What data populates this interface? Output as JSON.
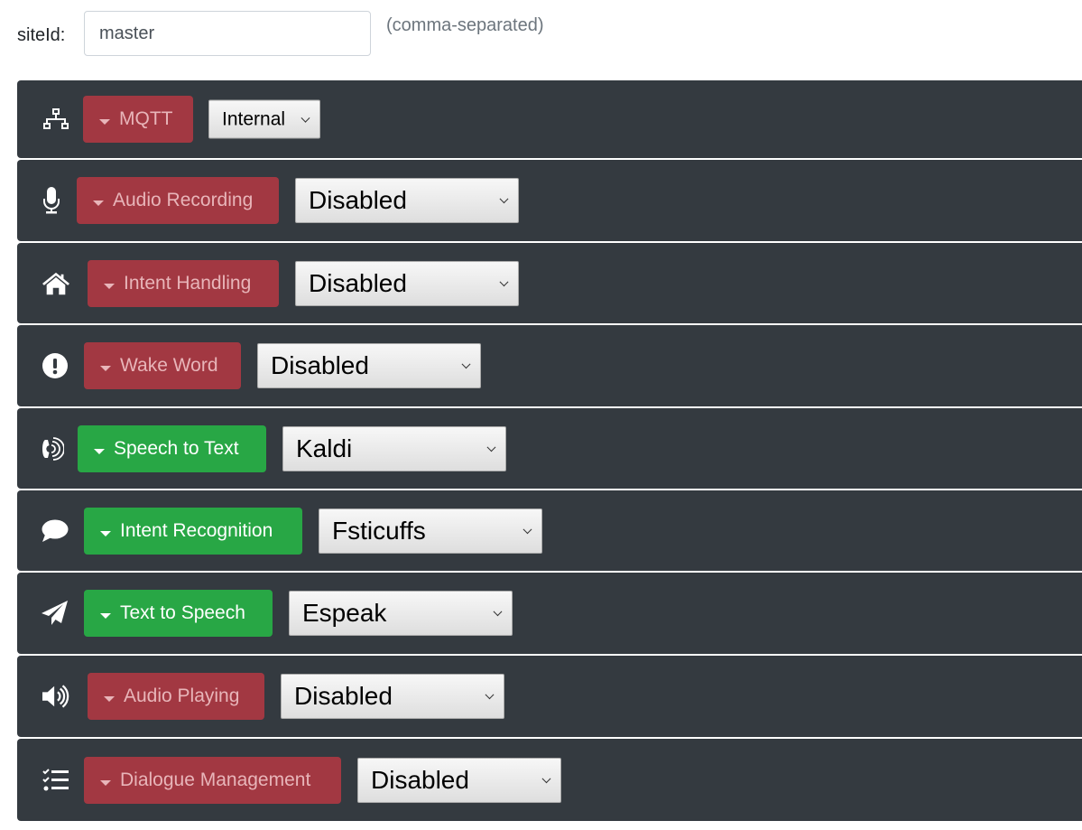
{
  "site": {
    "label": "siteId:",
    "value": "master",
    "hint": "(comma-separated)"
  },
  "services": [
    {
      "name": "MQTT",
      "icon": "network-icon",
      "state": "disabled",
      "selected": "Internal"
    },
    {
      "name": "Audio Recording",
      "icon": "microphone-icon",
      "state": "disabled",
      "selected": "Disabled"
    },
    {
      "name": "Intent Handling",
      "icon": "home-icon",
      "state": "disabled",
      "selected": "Disabled"
    },
    {
      "name": "Wake Word",
      "icon": "exclamation-circle-icon",
      "state": "disabled",
      "selected": "Disabled"
    },
    {
      "name": "Speech to Text",
      "icon": "phone-volume-icon",
      "state": "enabled",
      "selected": "Kaldi"
    },
    {
      "name": "Intent Recognition",
      "icon": "comment-icon",
      "state": "enabled",
      "selected": "Fsticuffs"
    },
    {
      "name": "Text to Speech",
      "icon": "paper-plane-icon",
      "state": "enabled",
      "selected": "Espeak"
    },
    {
      "name": "Audio Playing",
      "icon": "volume-up-icon",
      "state": "disabled",
      "selected": "Disabled"
    },
    {
      "name": "Dialogue Management",
      "icon": "tasks-icon",
      "state": "disabled",
      "selected": "Disabled"
    }
  ],
  "colors": {
    "panel_bg": "#343a40",
    "disabled_button": "#a23842",
    "enabled_button": "#28a745"
  }
}
